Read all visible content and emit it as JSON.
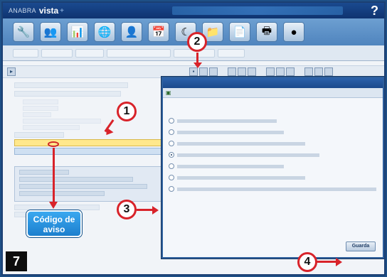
{
  "app": {
    "brand_prefix": "ANABRA",
    "brand_name": "vista",
    "brand_suffix": "+",
    "help_icon": "?"
  },
  "icon_bar": {
    "icons": [
      "wrench-icon",
      "people-icon",
      "chart-icon",
      "globe-icon",
      "person-icon",
      "calendar-icon",
      "moon-icon",
      "folder-icon",
      "document-icon",
      "printer-icon",
      "sphere-icon"
    ]
  },
  "dialog": {
    "ok_label": "Guarda"
  },
  "callouts": {
    "aviso_label": "Código de aviso",
    "numbers": [
      "1",
      "2",
      "3",
      "4"
    ],
    "step_number": "7"
  },
  "colors": {
    "callout_red": "#d8232a",
    "aviso_blue": "#1c7fce",
    "frame_blue": "#1e4f86"
  }
}
